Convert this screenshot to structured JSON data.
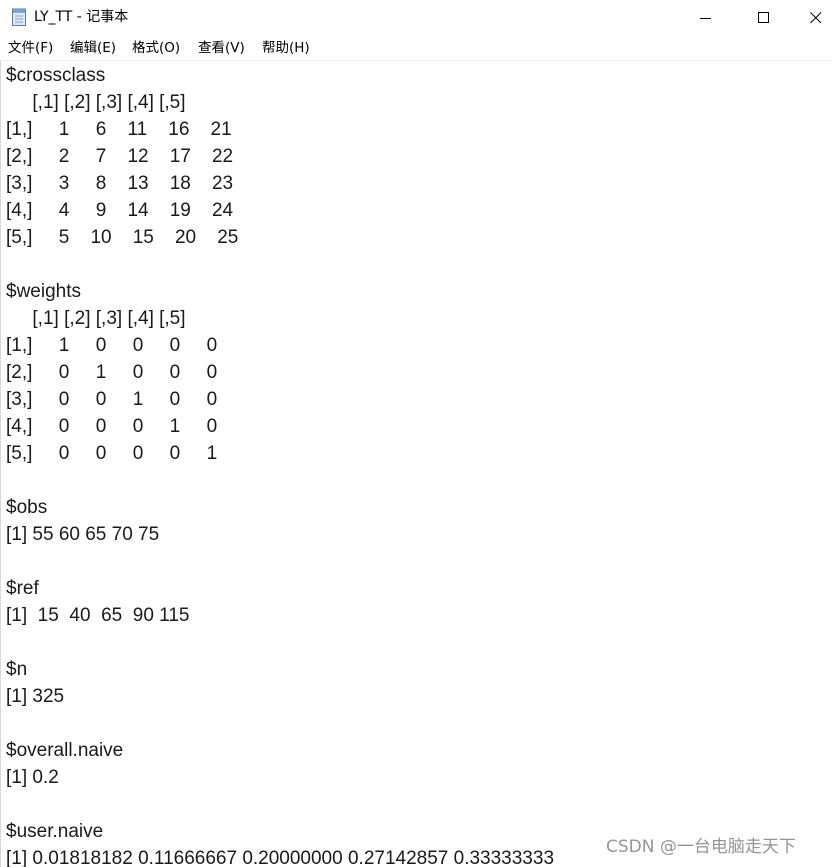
{
  "window": {
    "title": "LY_TT - 记事本"
  },
  "menubar": {
    "file": "文件(F)",
    "edit": "编辑(E)",
    "format": "格式(O)",
    "view": "查看(V)",
    "help": "帮助(H)"
  },
  "editor": {
    "lines": [
      "$crossclass",
      "     [,1] [,2] [,3] [,4] [,5]",
      "[1,]     1     6    11    16    21",
      "[2,]     2     7    12    17    22",
      "[3,]     3     8    13    18    23",
      "[4,]     4     9    14    19    24",
      "[5,]     5    10    15    20    25",
      "",
      "$weights",
      "     [,1] [,2] [,3] [,4] [,5]",
      "[1,]     1     0     0     0     0",
      "[2,]     0     1     0     0     0",
      "[3,]     0     0     1     0     0",
      "[4,]     0     0     0     1     0",
      "[5,]     0     0     0     0     1",
      "",
      "$obs",
      "[1] 55 60 65 70 75",
      "",
      "$ref",
      "[1]  15  40  65  90 115",
      "",
      "$n",
      "[1] 325",
      "",
      "$overall.naive",
      "[1] 0.2",
      "",
      "$user.naive",
      "[1] 0.01818182 0.11666667 0.20000000 0.27142857 0.33333333"
    ]
  },
  "watermark": {
    "text": "CSDN @一台电脑走天下"
  }
}
